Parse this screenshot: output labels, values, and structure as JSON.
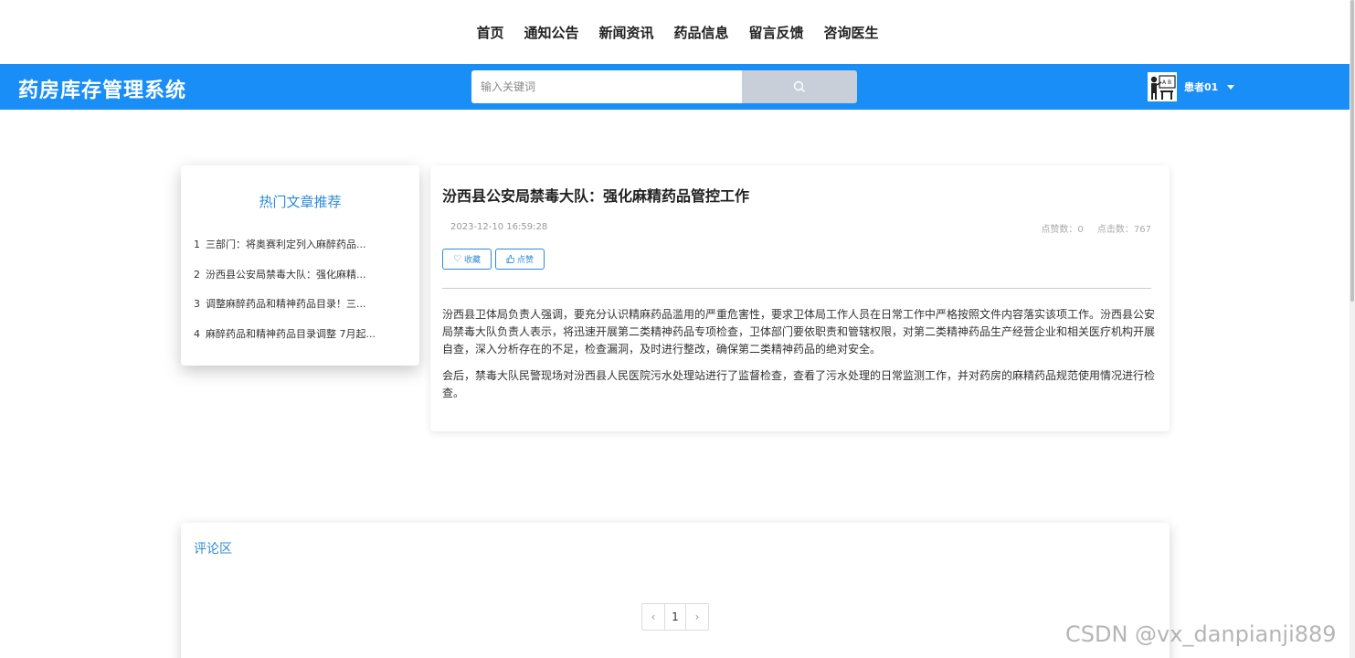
{
  "top_nav": {
    "items": [
      {
        "label": "首页"
      },
      {
        "label": "通知公告"
      },
      {
        "label": "新闻资讯"
      },
      {
        "label": "药品信息"
      },
      {
        "label": "留言反馈"
      },
      {
        "label": "咨询医生"
      }
    ]
  },
  "header": {
    "site_title": "药房库存管理系统",
    "search_placeholder": "输入关键词",
    "user_name": "患者01",
    "accent_color": "#1a8ef7"
  },
  "hot": {
    "title": "热门文章推荐",
    "items": [
      {
        "num": "1",
        "text": "三部门：将奥赛利定列入麻醉药品..."
      },
      {
        "num": "2",
        "text": "汾西县公安局禁毒大队：强化麻精..."
      },
      {
        "num": "3",
        "text": "调整麻醉药品和精神药品目录！三..."
      },
      {
        "num": "4",
        "text": "麻醉药品和精神药品目录调整 7月起..."
      }
    ]
  },
  "article": {
    "title": "汾西县公安局禁毒大队：强化麻精药品管控工作",
    "date": "2023-12-10 16:59:28",
    "likes": "点赞数：0",
    "clicks": "点击数：767",
    "collect_label": "收藏",
    "like_label": "点赞",
    "paragraphs": [
      "汾西县卫体局负责人强调，要充分认识精麻药品滥用的严重危害性，要求卫体局工作人员在日常工作中严格按照文件内容落实该项工作。汾西县公安局禁毒大队负责人表示，将迅速开展第二类精神药品专项检查，卫体部门要依职责和管辖权限，对第二类精神药品生产经营企业和相关医疗机构开展自查，深入分析存在的不足，检查漏洞，及时进行整改，确保第二类精神药品的绝对安全。",
      "会后，禁毒大队民警现场对汾西县人民医院污水处理站进行了监督检查，查看了污水处理的日常监测工作，并对药房的麻精药品规范使用情况进行检查。"
    ]
  },
  "comments": {
    "title": "评论区",
    "prev": "‹",
    "page": "1",
    "next": "›"
  },
  "watermark": "CSDN @vx_danpianji889"
}
